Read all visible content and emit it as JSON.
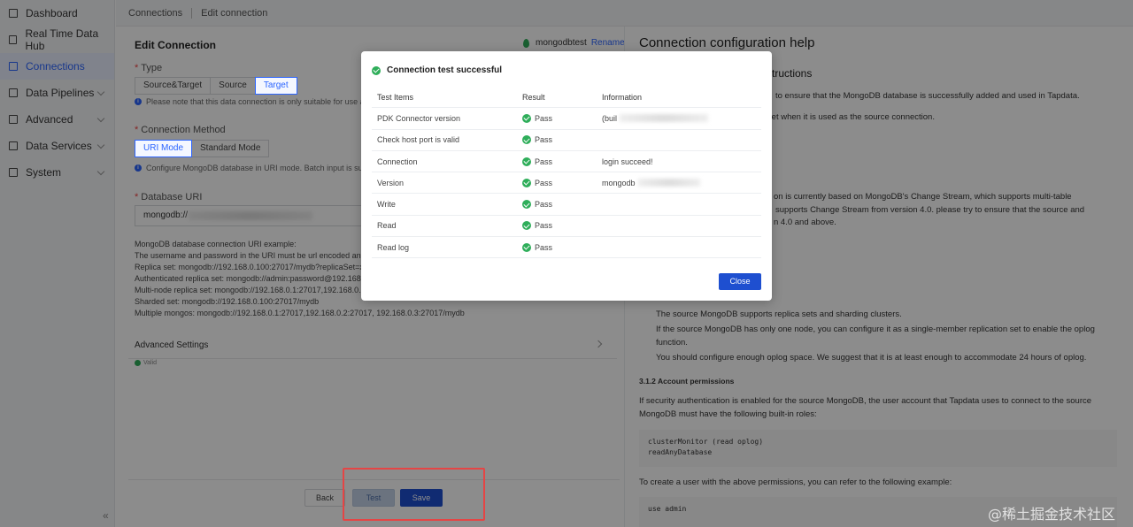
{
  "sidebar": {
    "items": [
      {
        "label": "Dashboard",
        "icon": "dashboard-icon",
        "active": false,
        "expandable": false
      },
      {
        "label": "Real Time Data Hub",
        "icon": "data-hub-icon",
        "active": false,
        "expandable": false
      },
      {
        "label": "Connections",
        "icon": "connections-icon",
        "active": true,
        "expandable": false
      },
      {
        "label": "Data Pipelines",
        "icon": "pipelines-icon",
        "active": false,
        "expandable": true
      },
      {
        "label": "Advanced",
        "icon": "advanced-icon",
        "active": false,
        "expandable": true
      },
      {
        "label": "Data Services",
        "icon": "services-icon",
        "active": false,
        "expandable": true
      },
      {
        "label": "System",
        "icon": "system-icon",
        "active": false,
        "expandable": true
      }
    ],
    "collapse_icon": "«"
  },
  "breadcrumb": {
    "root": "Connections",
    "current": "Edit connection"
  },
  "form": {
    "title": "Edit Connection",
    "connection_name": "mongodbtest",
    "rename_label": "Rename",
    "type_label": "Type",
    "type_options": [
      "Source&Target",
      "Source",
      "Target"
    ],
    "type_selected": 2,
    "type_hint": "Please note that this data connection is only suitable for use as a",
    "method_label": "Connection Method",
    "method_options": [
      "URI Mode",
      "Standard Mode"
    ],
    "method_selected": 0,
    "method_hint": "Configure MongoDB database in URI mode. Batch input is suppo",
    "uri_label": "Database URI",
    "uri_value": "mongodb://",
    "example_lines": [
      "MongoDB database connection URI example:",
      "The username and password in the URI must be url encoded and the",
      "Replica set: mongodb://192.168.0.100:27017/mydb?replicaSet=xxx",
      " Authenticated replica set: mongodb://admin:password@192.168.0.1",
      "Multi-node replica set: mongodb://192.168.0.1:27017,192.168.0.2:27",
      "Sharded set: mongodb://192.168.0.100:27017/mydb",
      "Multiple mongos: mongodb://192.168.0.1:27017,192.168.0.2:27017, 192.168.0.3:27017/mydb"
    ],
    "advanced_label": "Advanced Settings",
    "valid_label": "Valid",
    "buttons": {
      "back": "Back",
      "test": "Test",
      "save": "Save"
    }
  },
  "help": {
    "title": "Connection configuration help",
    "subtitle": "structions",
    "paragraphs": [
      "to ensure that the MongoDB database is successfully added and used in Tapdata.",
      "a set when it is used as the source connection.",
      "on is currently based on MongoDB's Change Stream, which supports multi-table",
      "supports Change Stream from version 4.0. please try to ensure that the source and",
      "n 4.0 and above.",
      "The source MongoDB supports replica sets and sharding clusters.",
      "If the source MongoDB has only one node, you can configure it as a single-member replication set to enable the oplog",
      "function.",
      "You should configure enough oplog space. We suggest that it is at least enough to accommodate 24 hours of oplog.",
      "3.1.2 Account permissions",
      "If security authentication is enabled for the source MongoDB, the user account that Tapdata uses to connect to the source",
      "MongoDB must have the following built-in roles:",
      "To create a user with the above permissions, you can refer to the following example:"
    ],
    "code_block_1": [
      "clusterMonitor (read oplog)",
      "readAnyDatabase"
    ],
    "code_block_2": [
      "use admin"
    ]
  },
  "modal": {
    "title": "Connection test successful",
    "headers": [
      "Test Items",
      "Result",
      "Information"
    ],
    "rows": [
      {
        "item": "PDK Connector version",
        "result": "Pass",
        "info": "(buil"
      },
      {
        "item": "Check host port is valid",
        "result": "Pass",
        "info": ""
      },
      {
        "item": "Connection",
        "result": "Pass",
        "info": "login succeed!"
      },
      {
        "item": "Version",
        "result": "Pass",
        "info": "mongodb"
      },
      {
        "item": "Write",
        "result": "Pass",
        "info": ""
      },
      {
        "item": "Read",
        "result": "Pass",
        "info": ""
      },
      {
        "item": "Read log",
        "result": "Pass",
        "info": ""
      }
    ],
    "close_label": "Close"
  },
  "watermark": "@稀土掘金技术社区",
  "colors": {
    "accent": "#2c65ff",
    "primary_button": "#1e4fd0",
    "success": "#2fae5a",
    "highlight_box": "#e54545"
  }
}
